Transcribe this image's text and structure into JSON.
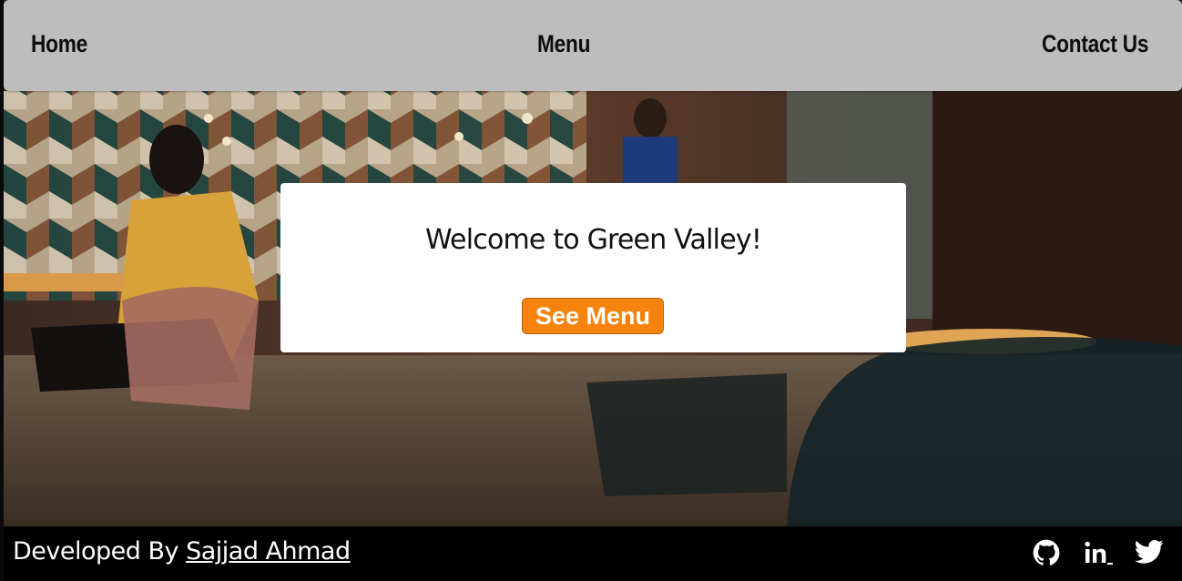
{
  "nav": {
    "home_label": "Home",
    "menu_label": "Menu",
    "contact_label": "Contact Us"
  },
  "hero": {
    "title": "Welcome to Green Valley!",
    "button_label": "See Menu",
    "button_color": "#f7830f"
  },
  "footer": {
    "prefix": "Developed By",
    "author": "Sajjad Ahmad",
    "social_icons": [
      "github-icon",
      "linkedin-icon",
      "twitter-icon"
    ]
  },
  "colors": {
    "navbar_bg": "#bdbdbd",
    "footer_bg": "#000000",
    "card_bg": "#ffffff"
  }
}
